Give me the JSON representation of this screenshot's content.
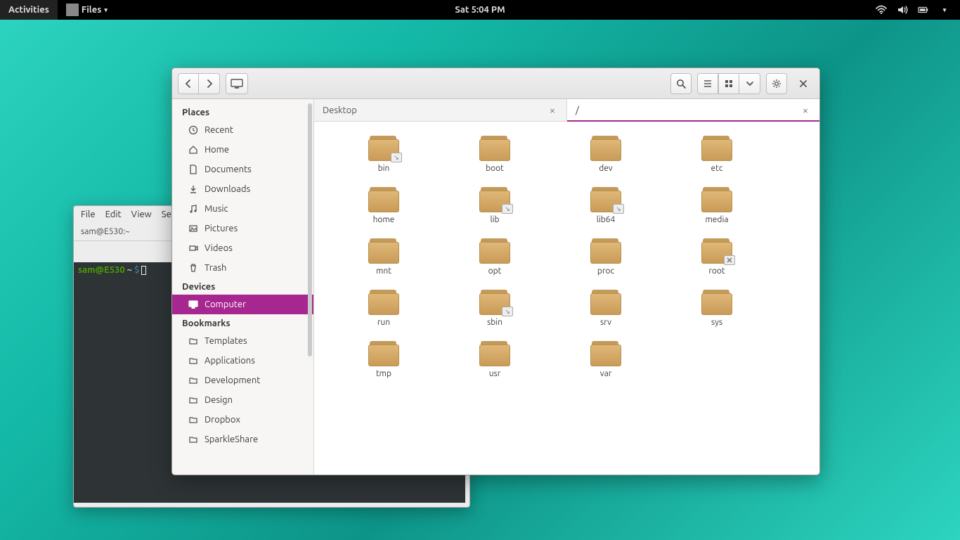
{
  "topbar": {
    "activities": "Activities",
    "app_name": "Files",
    "clock": "Sat  5:04 PM"
  },
  "terminal": {
    "menu": [
      "File",
      "Edit",
      "View",
      "Se"
    ],
    "tab_label": "sam@E530:~",
    "prompt_user": "sam@E530",
    "prompt_path": " ~ ",
    "prompt_symbol": "$ "
  },
  "files": {
    "path_button": "",
    "sidebar": {
      "places_heading": "Places",
      "places": [
        "Recent",
        "Home",
        "Documents",
        "Downloads",
        "Music",
        "Pictures",
        "Videos",
        "Trash"
      ],
      "devices_heading": "Devices",
      "devices": [
        "Computer"
      ],
      "bookmarks_heading": "Bookmarks",
      "bookmarks": [
        "Templates",
        "Applications",
        "Development",
        "Design",
        "Dropbox",
        "SparkleShare"
      ]
    },
    "tabs": [
      {
        "label": "Desktop",
        "active": false
      },
      {
        "label": "/",
        "active": true
      }
    ],
    "folders": [
      {
        "name": "bin",
        "badge": "link"
      },
      {
        "name": "boot",
        "badge": null
      },
      {
        "name": "dev",
        "badge": null
      },
      {
        "name": "etc",
        "badge": null
      },
      {
        "name": "home",
        "badge": null
      },
      {
        "name": "lib",
        "badge": "link"
      },
      {
        "name": "lib64",
        "badge": "link"
      },
      {
        "name": "media",
        "badge": null
      },
      {
        "name": "mnt",
        "badge": null
      },
      {
        "name": "opt",
        "badge": null
      },
      {
        "name": "proc",
        "badge": null
      },
      {
        "name": "root",
        "badge": "lock"
      },
      {
        "name": "run",
        "badge": null
      },
      {
        "name": "sbin",
        "badge": "link"
      },
      {
        "name": "srv",
        "badge": null
      },
      {
        "name": "sys",
        "badge": null
      },
      {
        "name": "tmp",
        "badge": null
      },
      {
        "name": "usr",
        "badge": null
      },
      {
        "name": "var",
        "badge": null
      }
    ]
  }
}
